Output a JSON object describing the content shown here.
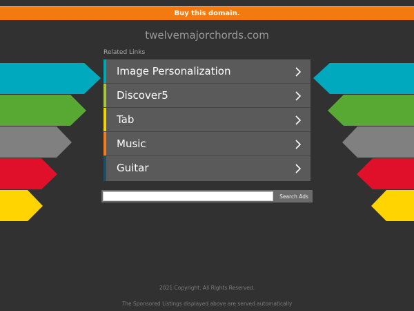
{
  "banner": {
    "buy_label": "Buy this domain."
  },
  "header": {
    "domain": "twelvemajorchords.com"
  },
  "related": {
    "heading": "Related Links",
    "items": [
      {
        "label": "Image Personalization",
        "color": "#00a7b5"
      },
      {
        "label": "Discover5",
        "color": "#a6c63f"
      },
      {
        "label": "Tab",
        "color": "#f1d40e"
      },
      {
        "label": "Music",
        "color": "#f17e1e"
      },
      {
        "label": "Guitar",
        "color": "#1d4e63"
      }
    ]
  },
  "search": {
    "value": "",
    "button_label": "Search Ads"
  },
  "decor": {
    "arrow_colors": [
      "#00a9bd",
      "#57a933",
      "#808080",
      "#e0102a",
      "#ffd400"
    ]
  },
  "footer": {
    "copyright": "2021 Copyright. All Rights Reserved.",
    "disclaimer": "The Sponsored Listings displayed above are served automatically"
  }
}
